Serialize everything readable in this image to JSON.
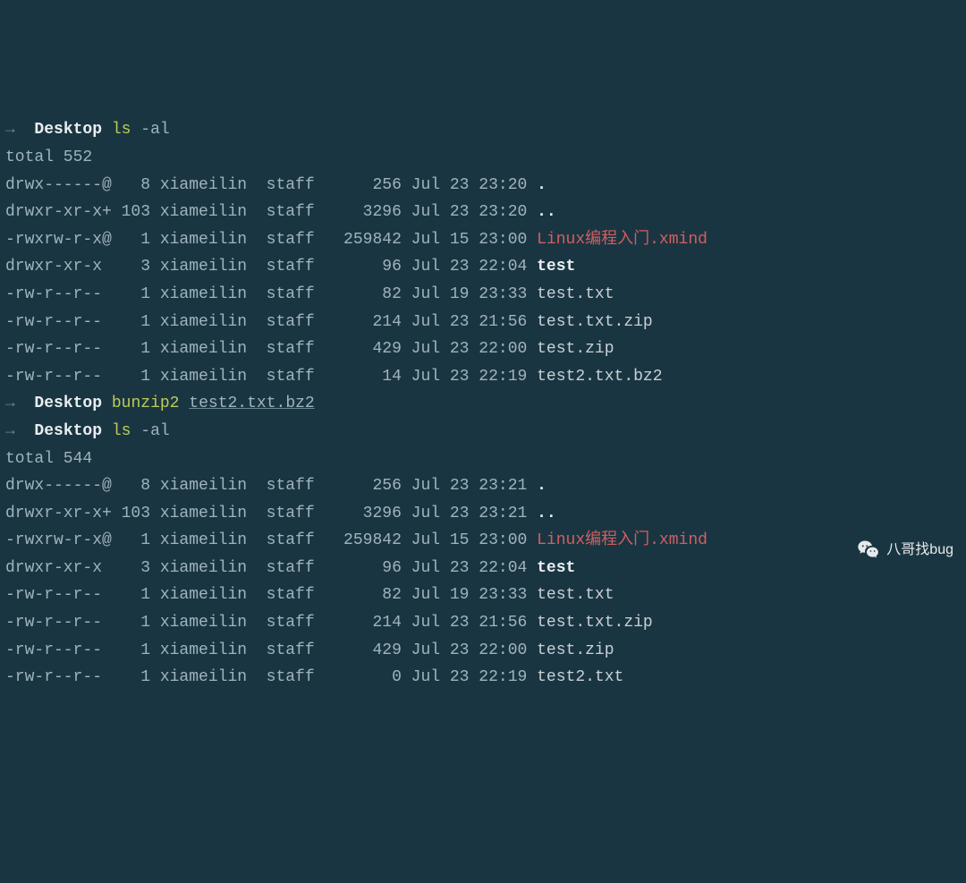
{
  "prompts": [
    {
      "arrow": "→",
      "cwd": "Desktop",
      "cmd": "ls",
      "args": "-al",
      "args_underline": false
    },
    {
      "arrow": "→",
      "cwd": "Desktop",
      "cmd": "bunzip2",
      "args": "test2.txt.bz2",
      "args_underline": true
    },
    {
      "arrow": "→",
      "cwd": "Desktop",
      "cmd": "ls",
      "args": "-al",
      "args_underline": false
    }
  ],
  "listing1": {
    "total": "total 552",
    "rows": [
      {
        "perm": "drwx------@",
        "links": "  8",
        "owner": "xiameilin",
        "group": "staff",
        "size": "    256",
        "date": "Jul 23 23:20",
        "name": ".",
        "style": "fdir"
      },
      {
        "perm": "drwxr-xr-x+",
        "links": "103",
        "owner": "xiameilin",
        "group": "staff",
        "size": "   3296",
        "date": "Jul 23 23:20",
        "name": "..",
        "style": "fdir"
      },
      {
        "perm": "-rwxrw-r-x@",
        "links": "  1",
        "owner": "xiameilin",
        "group": "staff",
        "size": " 259842",
        "date": "Jul 15 23:00",
        "name": "Linux编程入门.xmind",
        "style": "xmind"
      },
      {
        "perm": "drwxr-xr-x ",
        "links": "  3",
        "owner": "xiameilin",
        "group": "staff",
        "size": "     96",
        "date": "Jul 23 22:04",
        "name": "test",
        "style": "fdir"
      },
      {
        "perm": "-rw-r--r-- ",
        "links": "  1",
        "owner": "xiameilin",
        "group": "staff",
        "size": "     82",
        "date": "Jul 19 23:33",
        "name": "test.txt",
        "style": "fname"
      },
      {
        "perm": "-rw-r--r-- ",
        "links": "  1",
        "owner": "xiameilin",
        "group": "staff",
        "size": "    214",
        "date": "Jul 23 21:56",
        "name": "test.txt.zip",
        "style": "fname"
      },
      {
        "perm": "-rw-r--r-- ",
        "links": "  1",
        "owner": "xiameilin",
        "group": "staff",
        "size": "    429",
        "date": "Jul 23 22:00",
        "name": "test.zip",
        "style": "fname"
      },
      {
        "perm": "-rw-r--r-- ",
        "links": "  1",
        "owner": "xiameilin",
        "group": "staff",
        "size": "     14",
        "date": "Jul 23 22:19",
        "name": "test2.txt.bz2",
        "style": "fname"
      }
    ]
  },
  "listing2": {
    "total": "total 544",
    "rows": [
      {
        "perm": "drwx------@",
        "links": "  8",
        "owner": "xiameilin",
        "group": "staff",
        "size": "    256",
        "date": "Jul 23 23:21",
        "name": ".",
        "style": "fdir"
      },
      {
        "perm": "drwxr-xr-x+",
        "links": "103",
        "owner": "xiameilin",
        "group": "staff",
        "size": "   3296",
        "date": "Jul 23 23:21",
        "name": "..",
        "style": "fdir"
      },
      {
        "perm": "-rwxrw-r-x@",
        "links": "  1",
        "owner": "xiameilin",
        "group": "staff",
        "size": " 259842",
        "date": "Jul 15 23:00",
        "name": "Linux编程入门.xmind",
        "style": "xmind"
      },
      {
        "perm": "drwxr-xr-x ",
        "links": "  3",
        "owner": "xiameilin",
        "group": "staff",
        "size": "     96",
        "date": "Jul 23 22:04",
        "name": "test",
        "style": "fdir"
      },
      {
        "perm": "-rw-r--r-- ",
        "links": "  1",
        "owner": "xiameilin",
        "group": "staff",
        "size": "     82",
        "date": "Jul 19 23:33",
        "name": "test.txt",
        "style": "fname"
      },
      {
        "perm": "-rw-r--r-- ",
        "links": "  1",
        "owner": "xiameilin",
        "group": "staff",
        "size": "    214",
        "date": "Jul 23 21:56",
        "name": "test.txt.zip",
        "style": "fname"
      },
      {
        "perm": "-rw-r--r-- ",
        "links": "  1",
        "owner": "xiameilin",
        "group": "staff",
        "size": "    429",
        "date": "Jul 23 22:00",
        "name": "test.zip",
        "style": "fname"
      },
      {
        "perm": "-rw-r--r-- ",
        "links": "  1",
        "owner": "xiameilin",
        "group": "staff",
        "size": "      0",
        "date": "Jul 23 22:19",
        "name": "test2.txt",
        "style": "fname"
      }
    ]
  },
  "watermark": "八哥找bug"
}
